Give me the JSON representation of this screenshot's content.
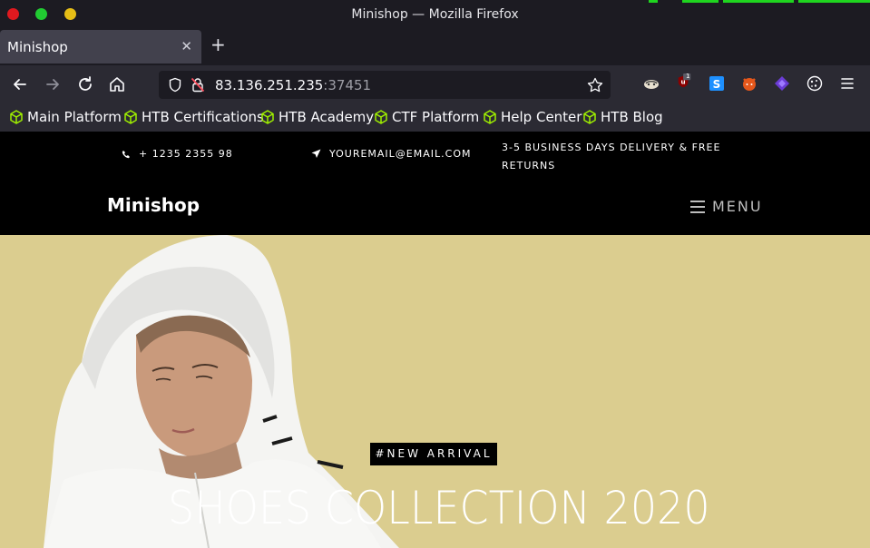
{
  "window": {
    "title": "Minishop — Mozilla Firefox"
  },
  "tabs": [
    {
      "title": "Minishop"
    }
  ],
  "urlbar": {
    "host": "83.136.251.235",
    "port": ":37451"
  },
  "bookmarks": [
    {
      "label": "Main Platform"
    },
    {
      "label": "HTB Certifications"
    },
    {
      "label": "HTB Academy"
    },
    {
      "label": "CTF Platform"
    },
    {
      "label": "Help Center"
    },
    {
      "label": "HTB Blog"
    }
  ],
  "extensions": {
    "ublock_badge": "1"
  },
  "site": {
    "topbar": {
      "phone": "+ 1235 2355 98",
      "email": "YOUREMAIL@EMAIL.COM",
      "delivery_line1": "3-5 BUSINESS DAYS DELIVERY & FREE",
      "delivery_line2": "RETURNS"
    },
    "brand": "Minishop",
    "menu_label": "MENU",
    "hero": {
      "badge": "#NEW ARRIVAL",
      "headline": "SHOES COLLECTION 2020"
    }
  },
  "colors": {
    "chrome_dark": "#1c1b22",
    "chrome": "#2b2a33",
    "hero_bg": "#dbcd8f",
    "htb_green": "#9fef00"
  }
}
